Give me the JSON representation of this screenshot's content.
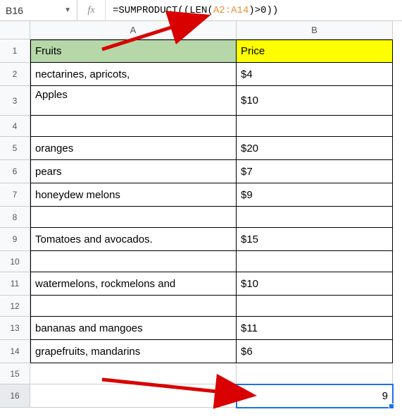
{
  "name_box": "B16",
  "fx_label": "fx",
  "formula_prefix": "=SUMPRODUCT((LEN(",
  "formula_range": "A2:A14",
  "formula_suffix": ")>0))",
  "col_headers": [
    "A",
    "B"
  ],
  "row_headers": [
    "1",
    "2",
    "3",
    "4",
    "5",
    "6",
    "7",
    "8",
    "9",
    "10",
    "11",
    "12",
    "13",
    "14",
    "15",
    "16"
  ],
  "headers": {
    "a": "Fruits",
    "b": "Price"
  },
  "rows": [
    {
      "a": "nectarines, apricots,",
      "b": "$4"
    },
    {
      "a": "Apples",
      "b": "$10"
    },
    {
      "a": "",
      "b": ""
    },
    {
      "a": "oranges",
      "b": "$20"
    },
    {
      "a": "pears",
      "b": "$7"
    },
    {
      "a": "honeydew melons",
      "b": "$9"
    },
    {
      "a": "",
      "b": ""
    },
    {
      "a": "Tomatoes and avocados.",
      "b": "$15"
    },
    {
      "a": "",
      "b": ""
    },
    {
      "a": "watermelons, rockmelons and",
      "b": "$10"
    },
    {
      "a": "",
      "b": ""
    },
    {
      "a": "bananas and mangoes",
      "b": "$11"
    },
    {
      "a": "grapefruits, mandarins",
      "b": "$6"
    }
  ],
  "result_cell": "9",
  "chart_data": {
    "type": "table",
    "title": "",
    "columns": [
      "Fruits",
      "Price"
    ],
    "data": [
      [
        "nectarines, apricots,",
        "$4"
      ],
      [
        "Apples",
        "$10"
      ],
      [
        "",
        ""
      ],
      [
        "oranges",
        "$20"
      ],
      [
        "pears",
        "$7"
      ],
      [
        "honeydew melons",
        "$9"
      ],
      [
        "",
        ""
      ],
      [
        "Tomatoes and avocados.",
        "$15"
      ],
      [
        "",
        ""
      ],
      [
        "watermelons, rockmelons and",
        "$10"
      ],
      [
        "",
        ""
      ],
      [
        "bananas and mangoes",
        "$11"
      ],
      [
        "grapefruits, mandarins",
        "$6"
      ]
    ],
    "formula": "=SUMPRODUCT((LEN(A2:A14)>0))",
    "result": 9
  }
}
